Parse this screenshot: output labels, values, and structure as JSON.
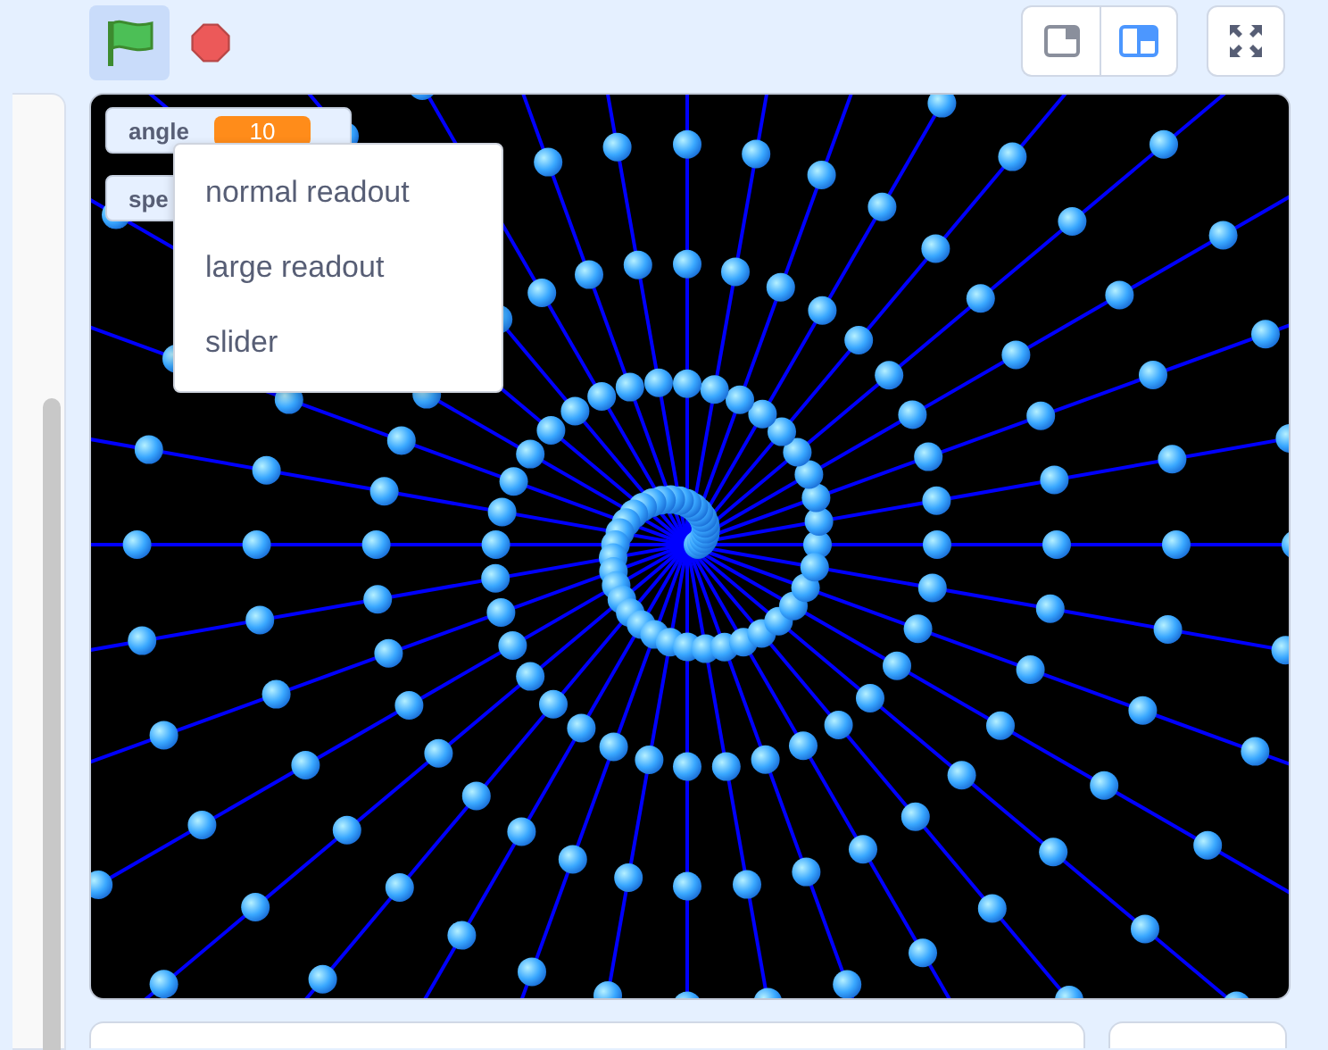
{
  "controls": {
    "green_flag": {
      "selected": true
    }
  },
  "stage_size_buttons": [
    {
      "kind": "small",
      "selected": false
    },
    {
      "kind": "normal",
      "selected": true
    }
  ],
  "monitors": [
    {
      "label": "angle",
      "value": "10"
    },
    {
      "label": "spe"
    }
  ],
  "context_menu": {
    "items": [
      "normal readout",
      "large readout",
      "slider"
    ]
  }
}
